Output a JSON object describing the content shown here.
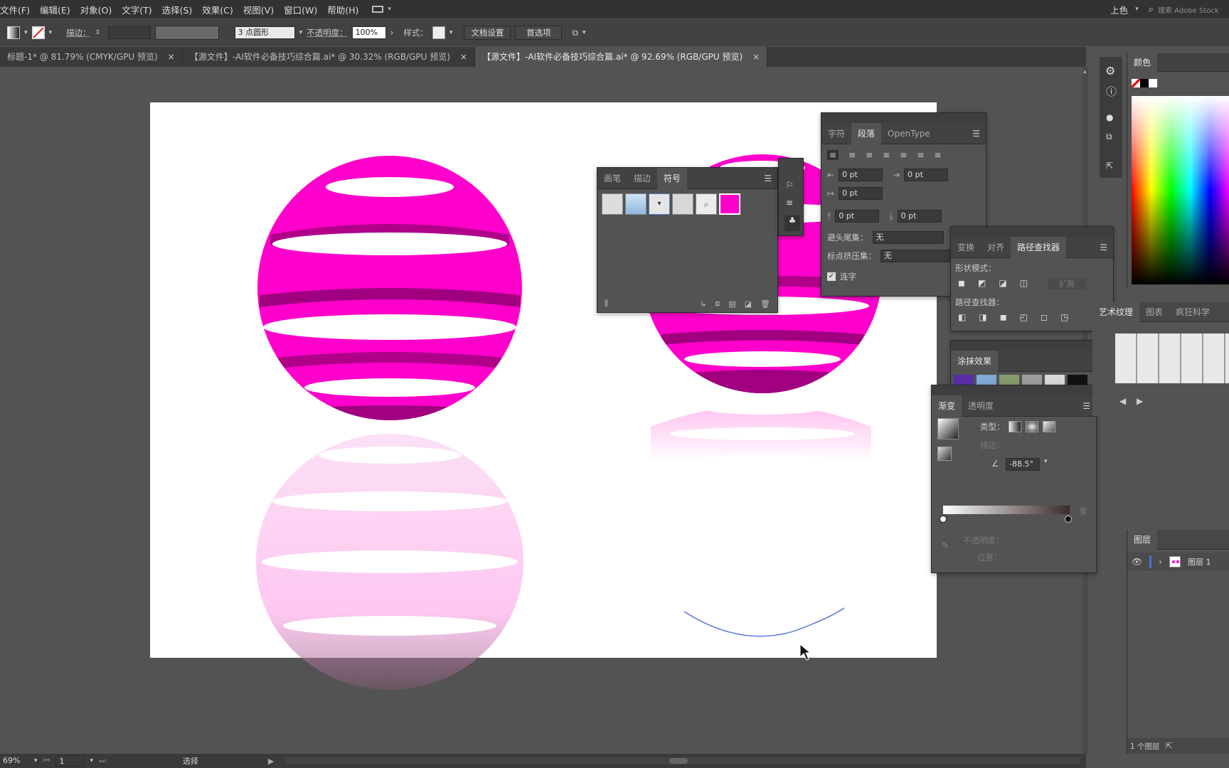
{
  "menu": [
    "文件(F)",
    "编辑(E)",
    "对象(O)",
    "文字(T)",
    "选择(S)",
    "效果(C)",
    "视图(V)",
    "窗口(W)",
    "帮助(H)"
  ],
  "top_right": {
    "workspace": "上色",
    "search_placeholder": "搜索 Adobe Stock"
  },
  "control": {
    "stroke_label": "描边：",
    "brush_value": "3 点圆形",
    "opacity_label": "不透明度：",
    "opacity_value": "100%",
    "style_label": "样式：",
    "doc_setup": "文档设置",
    "prefs": "首选项"
  },
  "tabs": [
    {
      "label": "标题-1* @ 81.79% (CMYK/GPU 预览)"
    },
    {
      "label": "【源文件】-AI软件必备技巧综合篇.ai* @ 30.32% (RGB/GPU 预览)"
    },
    {
      "label": "【源文件】-AI软件必备技巧综合篇.ai* @ 92.69% (RGB/GPU 预览)"
    }
  ],
  "close_glyph": "×",
  "symbols_panel": {
    "tabs": [
      "画笔",
      "描边",
      "符号"
    ]
  },
  "para_panel": {
    "tabs": [
      "字符",
      "段落",
      "OpenType"
    ],
    "pt": "0 pt",
    "avoid_label": "避头尾集：",
    "avoid_value": "无",
    "punct_label": "标点挤压集：",
    "punct_value": "无",
    "hyphen_label": "连字"
  },
  "pathfinder": {
    "tabs": [
      "变换",
      "对齐",
      "路径查找器"
    ],
    "shape_modes": "形状模式：",
    "pathfinders": "路径查找器：",
    "expand": "扩展"
  },
  "scribble": {
    "title": "涂抹效果"
  },
  "gradient": {
    "tabs": [
      "渐变",
      "透明度"
    ],
    "type_label": "类型：",
    "stroke_label": "描边：",
    "angle": "-88.5°",
    "opacity_label": "不透明度：",
    "location_label": "位置："
  },
  "right_dock": {
    "color_tab": "颜色",
    "art_tabs": [
      "艺术纹理",
      "图表",
      "疯狂科学"
    ],
    "layers_tab": "图层",
    "layer_name": "图层 1",
    "layer_count": "1 个图层"
  },
  "statusbar": {
    "zoom": "69%",
    "page": "1",
    "tool": "选择"
  },
  "colors": {
    "magenta": "#ff00cc",
    "dark_magenta": "#a0007f"
  }
}
